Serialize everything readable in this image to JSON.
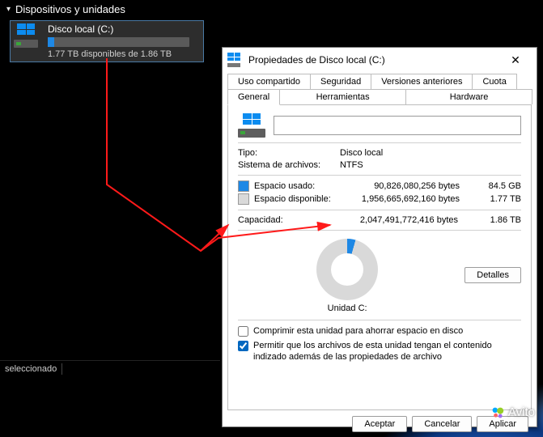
{
  "explorer": {
    "group_header": "Dispositivos y unidades",
    "device": {
      "name": "Disco local (C:)",
      "used_fraction": 0.048,
      "sub": "1.77 TB disponibles de 1.86 TB"
    },
    "status": "seleccionado"
  },
  "dialog": {
    "title": "Propiedades de Disco local (C:)",
    "tabs_top": [
      "Uso compartido",
      "Seguridad",
      "Versiones anteriores",
      "Cuota"
    ],
    "tabs_bottom": [
      "General",
      "Herramientas",
      "Hardware"
    ],
    "active_tab": "General",
    "label_input_value": "",
    "type_label": "Tipo:",
    "type_value": "Disco local",
    "fs_label": "Sistema de archivos:",
    "fs_value": "NTFS",
    "used": {
      "label": "Espacio usado:",
      "bytes": "90,826,080,256 bytes",
      "human": "84.5 GB",
      "color": "#1e88e5"
    },
    "free": {
      "label": "Espacio disponible:",
      "bytes": "1,956,665,692,160 bytes",
      "human": "1.77 TB",
      "color": "#d9d9d9"
    },
    "capacity": {
      "label": "Capacidad:",
      "bytes": "2,047,491,772,416 bytes",
      "human": "1.86 TB"
    },
    "unit_label": "Unidad C:",
    "details_btn": "Detalles",
    "check_compress": "Comprimir esta unidad para ahorrar espacio en disco",
    "check_index": "Permitir que los archivos de esta unidad tengan el contenido indizado además de las propiedades de archivo",
    "check_compress_checked": false,
    "check_index_checked": true,
    "ok_btn": "Aceptar",
    "cancel_btn": "Cancelar",
    "apply_btn": "Aplicar"
  },
  "watermark": "Avito",
  "chart_data": {
    "type": "pie",
    "title": "Unidad C:",
    "series": [
      {
        "name": "Espacio usado",
        "value_bytes": 90826080256,
        "value_human": "84.5 GB",
        "color": "#1e88e5"
      },
      {
        "name": "Espacio disponible",
        "value_bytes": 1956665692160,
        "value_human": "1.77 TB",
        "color": "#d9d9d9"
      }
    ],
    "total": {
      "name": "Capacidad",
      "value_bytes": 2047491772416,
      "value_human": "1.86 TB"
    }
  }
}
